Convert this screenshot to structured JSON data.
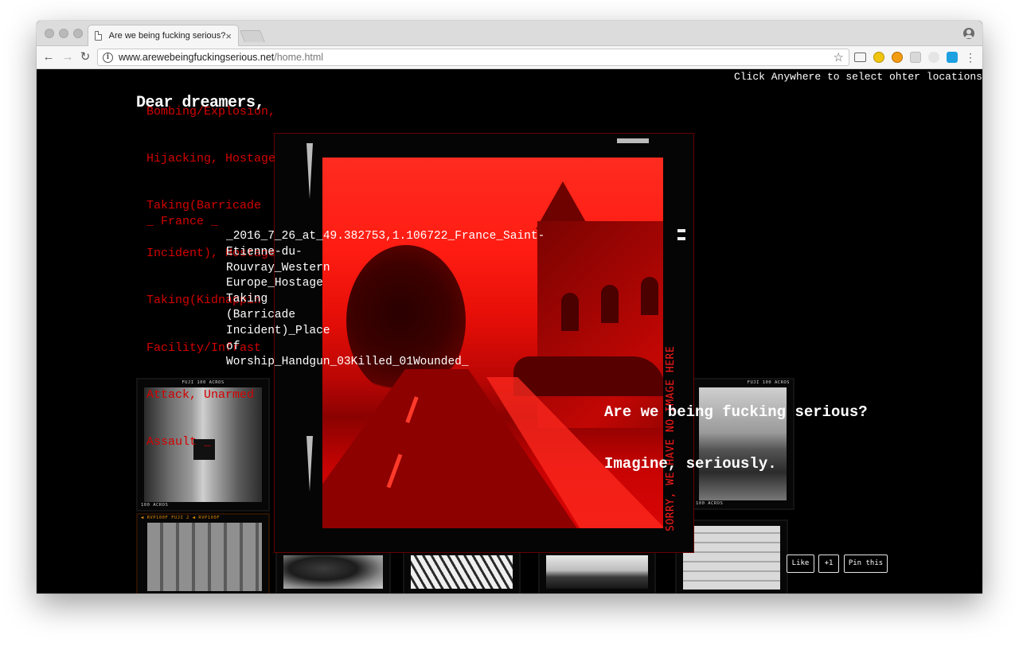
{
  "browser": {
    "tab_title": "Are we being fucking serious?",
    "tab_close": "×",
    "url_host": "www.arewebeingfuckingserious.net",
    "url_path": "/home.html",
    "back": "←",
    "forward": "→",
    "reload": "↻",
    "star": "☆",
    "menu": "⋮"
  },
  "page": {
    "hint": "Click Anywhere to select ohter locations",
    "greeting": "Dear dreamers,",
    "attack_types": [
      "Bombing/Explosion,",
      "Hijacking, Hostage",
      "Taking(Barricade",
      "Incident), Hostage",
      "Taking(Kidnappin",
      "Facility/Infrast",
      "Attack, Unarmed",
      "Assault _"
    ],
    "country": "_ France _",
    "caption_lines": [
      "_2016_7_26_at_49.382753,1.106722_France_Saint-",
      "Etienne-du-",
      "Rouvray_Western",
      "Europe_Hostage",
      "Taking",
      "(Barricade",
      "Incident)_Place",
      "of",
      "Worship_Handgun_03Killed_01Wounded_"
    ],
    "question": "Are we being fucking serious?",
    "imagine": "Imagine, seriously.",
    "vertical_text": "SORRY, WE HAVE NO IMAGE HERE",
    "film_edges": {
      "fuji_acros": "FUJI 100 ACROS",
      "acros": "100 ACROS",
      "rvp": "◀  RVP100F   FUJI   2  ◀  RVP100F"
    },
    "buttons": {
      "like": "Like",
      "plus_one": "+1",
      "pin": "Pin this"
    }
  },
  "colors": {
    "background": "#000000",
    "accent_red": "#d40000",
    "text_white": "#ffffff"
  }
}
